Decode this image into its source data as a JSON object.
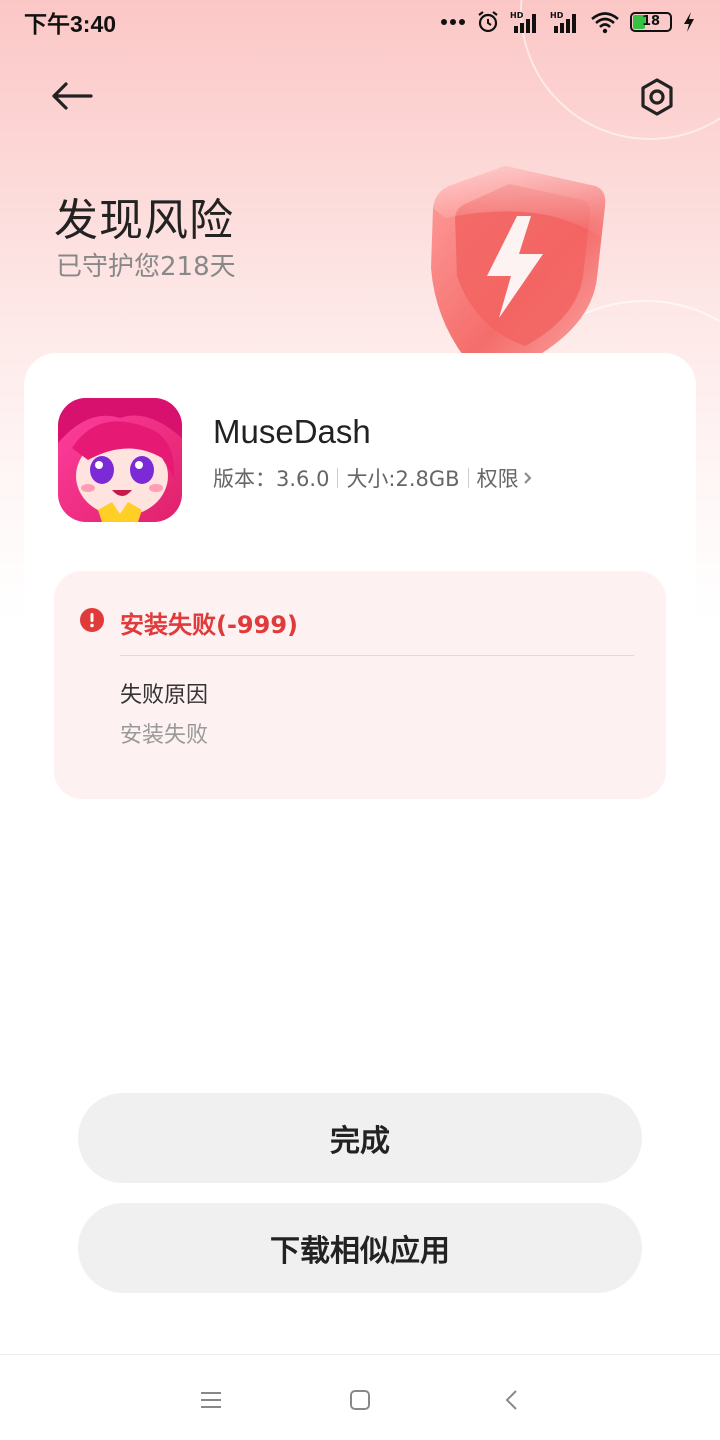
{
  "status_bar": {
    "time": "下午3:40",
    "battery_level": "18",
    "icons": [
      "more-dots-icon",
      "alarm-icon",
      "signal-hd-icon",
      "signal-hd-icon",
      "wifi-icon",
      "battery-icon",
      "charging-icon"
    ]
  },
  "header": {
    "back_icon": "arrow-left-icon",
    "settings_icon": "settings-gear-icon",
    "title": "发现风险",
    "subtitle": "已守护您218天"
  },
  "app": {
    "name": "MuseDash",
    "version": "版本：3.6.0",
    "size": "大小:2.8GB",
    "permissions_label": "权限"
  },
  "error": {
    "title": "安装失败(-999)",
    "reason_label": "失败原因",
    "reason_value": "安装失败"
  },
  "buttons": {
    "done": "完成",
    "download_similar": "下载相似应用"
  },
  "nav": {
    "icons": [
      "menu-icon",
      "home-square-icon",
      "back-chevron-icon"
    ]
  },
  "colors": {
    "error_red": "#e03a3a",
    "hero_pink": "#fbc7c6",
    "button_gray": "#f0f0f0"
  }
}
